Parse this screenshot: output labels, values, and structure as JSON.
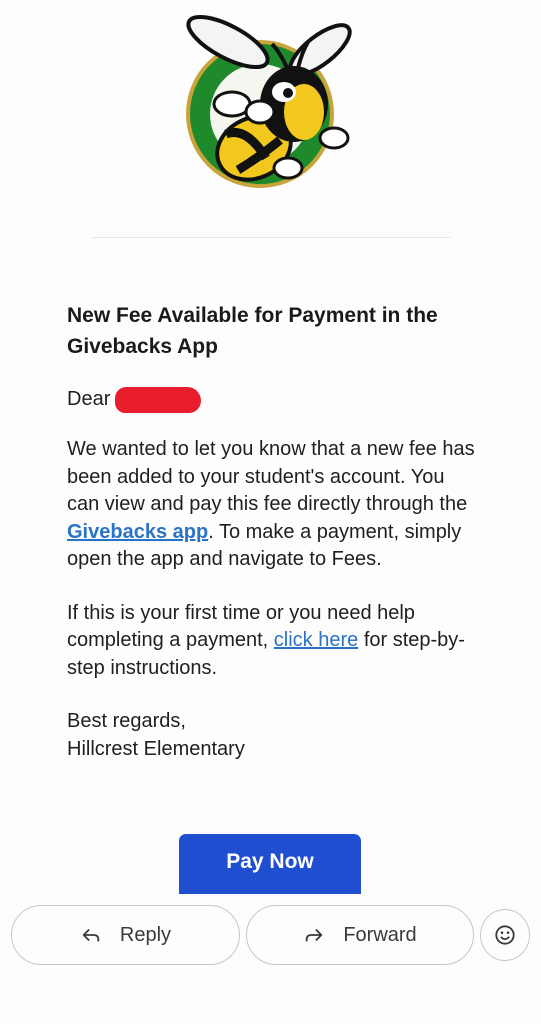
{
  "header": {
    "logo_name": "hornet-mascot-logo"
  },
  "email": {
    "title": "New Fee Available for Payment in the Givebacks App",
    "greeting_prefix": "Dear",
    "paragraph1": {
      "before_link": "We wanted to let you know that a new fee has been added to your student's account. You can view and pay this fee directly through the ",
      "link": "Givebacks app",
      "after_link": ". To make a payment, simply open the app and navigate to Fees."
    },
    "paragraph2": {
      "before_link": "If this is your first time or you need help completing a payment, ",
      "link": "click here",
      "after_link": " for step-by-step instructions."
    },
    "signoff": "Best regards,",
    "sender": "Hillcrest Elementary",
    "pay_button": "Pay Now"
  },
  "actions": {
    "reply": "Reply",
    "forward": "Forward",
    "emoji_icon": "smiley-icon"
  },
  "colors": {
    "link": "#2a73c7",
    "button": "#1f4fd0",
    "redaction": "#e81e2f"
  }
}
